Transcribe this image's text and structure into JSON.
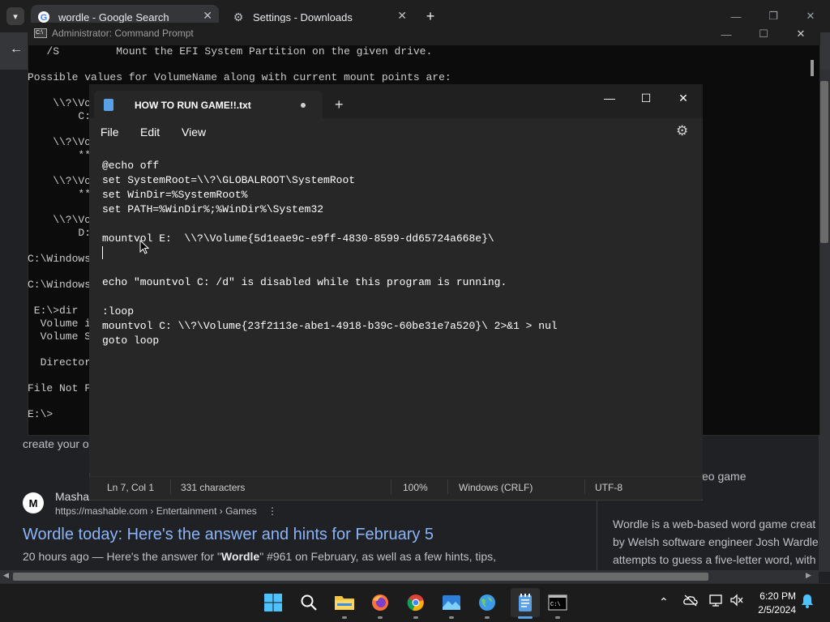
{
  "chrome": {
    "tab1_title": "wordle - Google Search",
    "tab2_title": "Settings - Downloads",
    "back_icon": "←",
    "close_icon": "✕",
    "newtab_icon": "+"
  },
  "search_results": {
    "partial_snippet": "create your o",
    "mashable_logo_text": "M",
    "mashable_site": "Masha",
    "mashable_url": "https://mashable.com › Entertainment › Games",
    "mashable_more": "⋮",
    "mashable_title": "Wordle today: Here's the answer and hints for February 5",
    "mashable_snippet_pre": "20 hours ago — Here's the answer for \"",
    "mashable_snippet_bold": "Wordle",
    "mashable_snippet_post": "\" #961 on February, as well as a few hints, tips,",
    "kp_video_game": "eo game",
    "kp_line1": "Wordle is a web-based word game creat",
    "kp_line2": "by Welsh software engineer Josh Wardle",
    "kp_line3": "attempts to guess a five-letter word, with"
  },
  "cmd": {
    "title": "Administrator: Command Prompt",
    "icon_text": "C:\\",
    "lines": "   /S         Mount the EFI System Partition on the given drive.\n\nPossible values for VolumeName along with current mount points are:\n\n    \\\\?\\Vo\n        C:\n\n    \\\\?\\Vo\n        **\n\n    \\\\?\\Vo\n        **\n\n    \\\\?\\Vo\n        D:\n\nC:\\Windows\n\nC:\\Windows\n\n E:\\>dir\n  Volume in\n  Volume Se\n\n  Directory\n\nFile Not F\n\nE:\\>"
  },
  "notepad": {
    "tab_title": "HOW TO RUN GAME!!.txt",
    "new_tab": "+",
    "minimize": "—",
    "maximize": "☐",
    "close": "✕",
    "menu_file": "File",
    "menu_edit": "Edit",
    "menu_view": "View",
    "settings_icon": "⚙",
    "content": "@echo off\nset SystemRoot=\\\\?\\GLOBALROOT\\SystemRoot\nset WinDir=%SystemRoot%\nset PATH=%WinDir%;%WinDir%\\System32\n\nmountvol E:  \\\\?\\Volume{5d1eae9c-e9ff-4830-8599-dd65724a668e}\\\n\n\necho \"mountvol C: /d\" is disabled while this program is running.\n\n:loop\nmountvol C: \\\\?\\Volume{23f2113e-abe1-4918-b39c-60be31e7a520}\\ 2>&1 > nul\ngoto loop",
    "status_position": "Ln 7, Col 1",
    "status_chars": "331 characters",
    "status_zoom": "100%",
    "status_eol": "Windows (CRLF)",
    "status_encoding": "UTF-8"
  },
  "taskbar": {
    "time": "6:20 PM",
    "date": "2/5/2024",
    "tray_chevron": "⌃"
  },
  "colors": {
    "accent": "#5aa0e6",
    "link": "#8ab4f8"
  }
}
